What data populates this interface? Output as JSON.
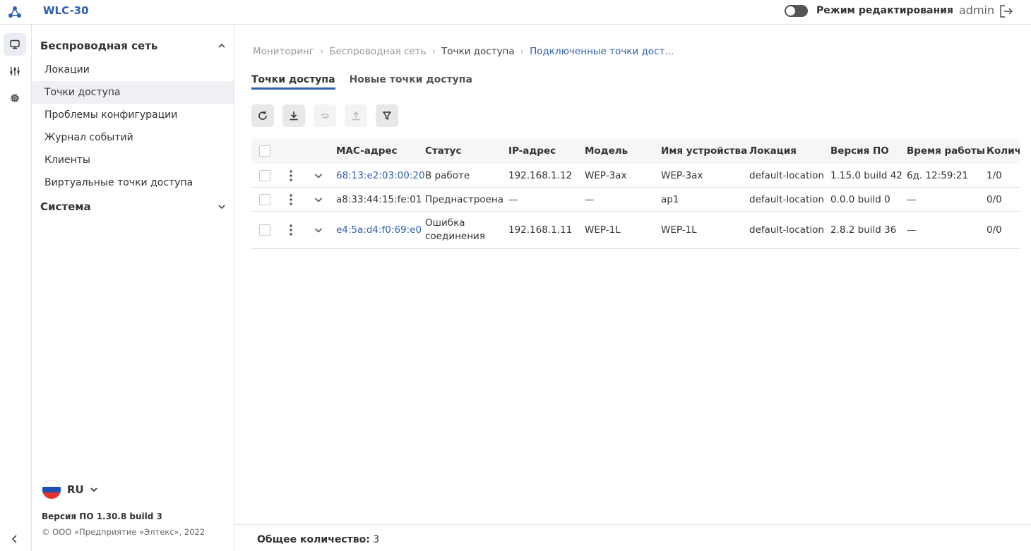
{
  "header": {
    "app_title": "WLC-30",
    "edit_mode_label": "Режим редактирования",
    "user_name": "admin"
  },
  "rail": {
    "items": [
      "monitor-icon",
      "equalizer-icon",
      "gear-icon"
    ],
    "collapse_icon": "chevron-left-icon"
  },
  "sidebar": {
    "section_wireless": "Беспроводная сеть",
    "items": [
      {
        "label": "Локации"
      },
      {
        "label": "Точки доступа"
      },
      {
        "label": "Проблемы конфигурации"
      },
      {
        "label": "Журнал событий"
      },
      {
        "label": "Клиенты"
      },
      {
        "label": "Виртуальные точки доступа"
      }
    ],
    "section_system": "Система",
    "language": "RU",
    "version": "Версия ПО 1.30.8 build 3",
    "copyright": "© ООО «Предприятие «Элтекс», 2022"
  },
  "breadcrumb": [
    "Мониторинг",
    "Беспроводная сеть",
    "Точки доступа",
    "Подключенные точки дост..."
  ],
  "tabs": [
    "Точки доступа",
    "Новые точки доступа"
  ],
  "toolbar": {
    "buttons": [
      "refresh-icon",
      "download-icon",
      "undo-icon",
      "upload-icon",
      "filter-icon"
    ]
  },
  "table": {
    "columns": [
      "MAC-адрес",
      "Статус",
      "IP-адрес",
      "Модель",
      "Имя устройства",
      "Локация",
      "Версия ПО",
      "Время работы",
      "Количество"
    ],
    "rows": [
      {
        "mac": "68:13:e2:03:00:20",
        "status": "В работе",
        "ip": "192.168.1.12",
        "model": "WEP-3ax",
        "name": "WEP-3ax",
        "location": "default-location",
        "fw": "1.15.0 build 42",
        "uptime": "6д. 12:59:21",
        "count": "1/0"
      },
      {
        "mac": "a8:33:44:15:fe:01",
        "status": "Преднастроена",
        "ip": "—",
        "model": "—",
        "name": "ap1",
        "location": "default-location",
        "fw": "0.0.0 build 0",
        "uptime": "—",
        "count": "0/0"
      },
      {
        "mac": "e4:5a:d4:f0:69:e0",
        "status": "Ошибка соединения",
        "ip": "192.168.1.11",
        "model": "WEP-1L",
        "name": "WEP-1L",
        "location": "default-location",
        "fw": "2.8.2 build 36",
        "uptime": "—",
        "count": "0/0"
      }
    ]
  },
  "footer": {
    "total_label": "Общее количество:",
    "total_value": "3"
  },
  "colors": {
    "accent": "#2f5fad",
    "toggle_off": "#555555"
  }
}
